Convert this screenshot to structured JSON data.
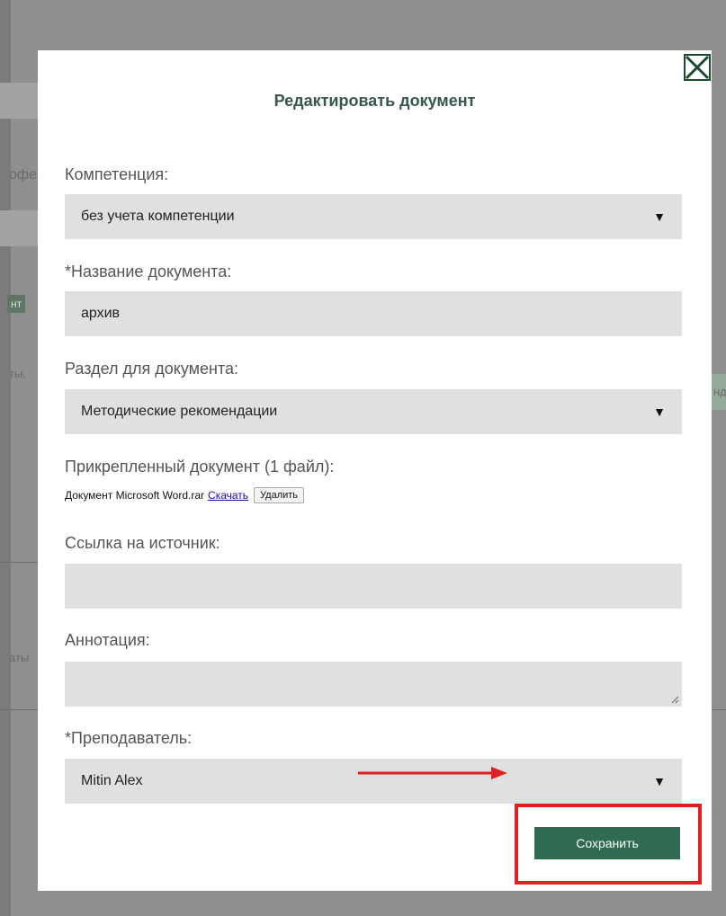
{
  "background": {
    "fragments": [
      "офе",
      "нт",
      "ты,",
      "нд",
      "аты"
    ]
  },
  "modal": {
    "title": "Редактировать документ",
    "competence": {
      "label": "Компетенция:",
      "value": "без учета компетенции"
    },
    "doc_name": {
      "label": "*Название документа:",
      "value": "архив"
    },
    "section": {
      "label": "Раздел для документа:",
      "value": "Методические рекомендации"
    },
    "attachment": {
      "label": "Прикрепленный документ (1 файл):",
      "file_name": "Документ Microsoft Word.rar",
      "download_label": "Скачать",
      "delete_label": "Удалить"
    },
    "source_link": {
      "label": "Ссылка на источник:",
      "value": ""
    },
    "annotation": {
      "label": "Аннотация:",
      "value": ""
    },
    "teacher": {
      "label": "*Преподаватель:",
      "value": "Mitin Alex"
    },
    "save_label": "Сохранить"
  },
  "colors": {
    "accent": "#2f6b50",
    "title": "#37574a",
    "highlight": "#e02020"
  },
  "icons": {
    "close": "close-icon",
    "caret": "chevron-down-icon"
  }
}
